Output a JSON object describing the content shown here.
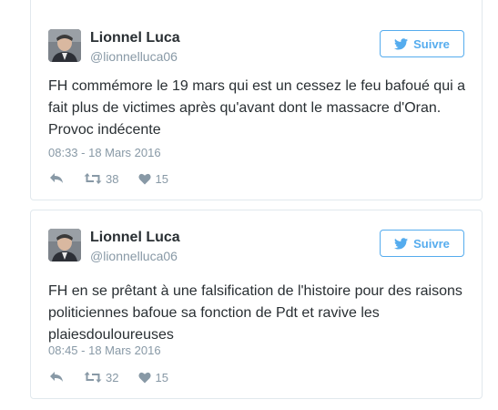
{
  "colors": {
    "accent": "#55acee",
    "border": "#e1e8ed",
    "muted": "#8899a6",
    "text": "#292f33"
  },
  "follow_icon": "twitter-bird-icon",
  "tweets": [
    {
      "author_name": "Lionnel Luca",
      "author_handle": "@lionnelluca06",
      "follow_label": "Suivre",
      "text": "FH commémore le 19 mars qui est un cessez le feu bafoué qui a fait plus de victimes après qu'avant dont le massacre d'Oran. Provoc indécente",
      "timestamp": "08:33 - 18 Mars 2016",
      "retweets": "38",
      "likes": "15"
    },
    {
      "author_name": "Lionnel Luca",
      "author_handle": "@lionnelluca06",
      "follow_label": "Suivre",
      "text": "FH en se prêtant à une falsification de l'histoire pour des raisons politiciennes bafoue sa fonction de Pdt et ravive les plaiesdouloureuses",
      "timestamp": "08:45 - 18 Mars 2016",
      "retweets": "32",
      "likes": "15"
    }
  ]
}
